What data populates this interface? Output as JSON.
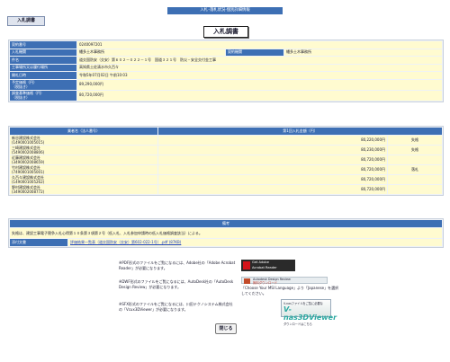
{
  "top_bar": "入札･落札状況-個別詳細情報",
  "tab_label": "入札調書",
  "page_title": "入札調書",
  "info": {
    "contract_no_label": "契約番号",
    "contract_no": "0240097201",
    "org_label": "入札機関",
    "org": "幡多土木事務所",
    "contract_org_label": "契約機関",
    "contract_org": "幡多土木事務所",
    "title_label": "件名",
    "title": "道交国防安（交安）第６０２－０２２－１号　国道３２１号　防災・安全交付金工事",
    "location_label": "工事場所又は履行場所",
    "location": "高知県土佐清水市久百々",
    "opening_label": "開札日時",
    "opening": "令和5年07月02日 午前10:03",
    "planned_label": "予定価格（円）\n（税抜き）",
    "planned": "89,290,000円",
    "survey_label": "調査基準価格（円）\n（税抜き）",
    "survey": "80,720,000円"
  },
  "bids": {
    "col_company": "業者名（法人番号）",
    "col_amount": "第1回入札金額（円）",
    "rows": [
      {
        "name": "新谷建設株式会社",
        "code": "(1490001005015)",
        "amount": "80,220,000円",
        "remark": "失格"
      },
      {
        "name": "三崎建設株式会社",
        "code": "(5490002008806)",
        "amount": "80,230,000円",
        "remark": "失格"
      },
      {
        "name": "近藤建設株式会社",
        "code": "(3490002008659)",
        "amount": "80,720,000円",
        "remark": ""
      },
      {
        "name": "竹村建設株式会社",
        "code": "(7490001005001)",
        "amount": "80,720,000円",
        "remark": "落札"
      },
      {
        "name": "久百々建設株式会社",
        "code": "(1490001005262)",
        "amount": "80,720,000円",
        "remark": ""
      },
      {
        "name": "野村建設株式会社",
        "code": "(3490002008772)",
        "amount": "80,720,000円",
        "remark": ""
      }
    ]
  },
  "remarks": {
    "header": "備考",
    "text": "失格は、建設工事電子競争入札心得第１０条第３項第２号（低入札、入札参加申請時の低入札価格調査該当）による。",
    "attach_label": "添付文書",
    "attach_link": "評価結果一覧表（道交国防安（交安）第602-022-1号）.pdf (87KB)"
  },
  "notes": {
    "pdf": "※PDF形式のファイルをご覧になるには、Adobe社の「Adobe Acrobat Reader」が必要になります。",
    "dwf": "※DWF形式のファイルをご覧になるには、AutoDesk社の「AutoDesk Design Review」が必要になります。",
    "sfx": "※SFX形式のファイルをご覧になるには、川田テクノシステム株式会社の「Vcux3DViewer」が必要になります。",
    "dr_text": "「Choose Your MSI Language」より「Japanese」を選択してください。"
  },
  "badges": {
    "acrobat_line1": "Get Adobe",
    "acrobat_line2": "Acrobat Reader",
    "dr_line1": "Autodesk Design Review",
    "dr_line2": "無料ダウンロード",
    "v3_line1": "V-nasファイルをご覧に必要な",
    "v3_big": "V-nas3DViewer",
    "v3_line2": "ダウンロードはこちら"
  },
  "close_label": "閉じる"
}
